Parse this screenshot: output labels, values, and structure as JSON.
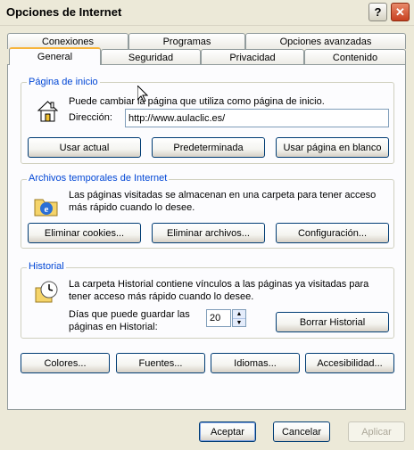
{
  "window": {
    "title": "Opciones de Internet"
  },
  "tabs_back": [
    "Conexiones",
    "Programas",
    "Opciones avanzadas"
  ],
  "tabs_front": [
    "General",
    "Seguridad",
    "Privacidad",
    "Contenido"
  ],
  "home": {
    "title": "Página de inicio",
    "description": "Puede cambiar la página que utiliza como página de inicio.",
    "address_label": "Dirección:",
    "address_value": "http://www.aulaclic.es/",
    "btn_current": "Usar actual",
    "btn_default": "Predeterminada",
    "btn_blank": "Usar página en blanco"
  },
  "temp": {
    "title": "Archivos temporales de Internet",
    "description": "Las páginas visitadas se almacenan en una carpeta para tener acceso más rápido cuando lo desee.",
    "btn_cookies": "Eliminar cookies...",
    "btn_files": "Eliminar archivos...",
    "btn_settings": "Configuración..."
  },
  "history": {
    "title": "Historial",
    "description": "La carpeta Historial contiene vínculos a las páginas ya visitadas para tener acceso más rápido cuando lo desee.",
    "days_label": "Días que puede guardar las páginas en Historial:",
    "days_value": "20",
    "btn_clear": "Borrar Historial"
  },
  "bottom_buttons": {
    "colors": "Colores...",
    "fonts": "Fuentes...",
    "languages": "Idiomas...",
    "accessibility": "Accesibilidad..."
  },
  "footer": {
    "ok": "Aceptar",
    "cancel": "Cancelar",
    "apply": "Aplicar"
  }
}
